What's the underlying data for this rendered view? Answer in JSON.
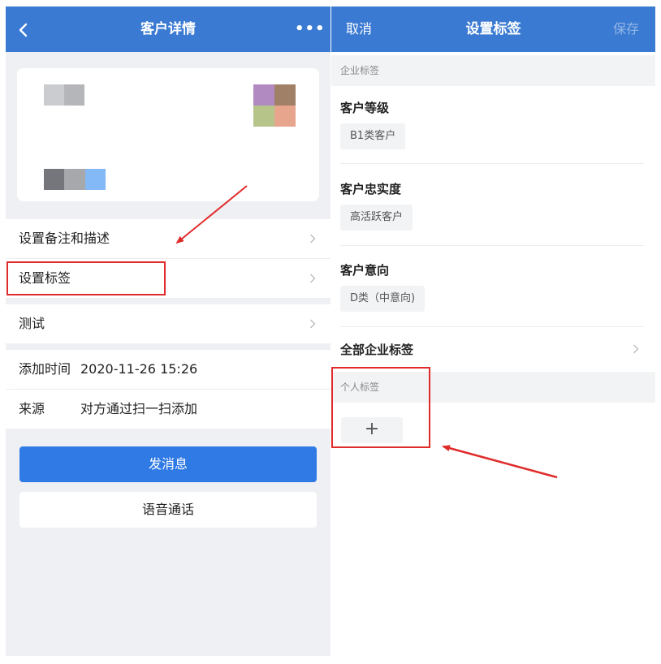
{
  "left": {
    "nav": {
      "title": "客户详情",
      "more": "•••"
    },
    "rows": {
      "remark": "设置备注和描述",
      "tags": "设置标签",
      "test": "测试",
      "add_time_label": "添加时间",
      "add_time_value": "2020-11-26 15:26",
      "source_label": "来源",
      "source_value": "对方通过扫一扫添加"
    },
    "buttons": {
      "send_message": "发消息",
      "voice_call": "语音通话"
    }
  },
  "right": {
    "nav": {
      "cancel": "取消",
      "title": "设置标签",
      "save": "保存"
    },
    "enterprise_section": "企业标签",
    "groups": [
      {
        "title": "客户等级",
        "tag": "B1类客户"
      },
      {
        "title": "客户忠实度",
        "tag": "高活跃客户"
      },
      {
        "title": "客户意向",
        "tag": "D类（中意向)"
      }
    ],
    "all_enterprise_tags": "全部企业标签",
    "personal_section": "个人标签",
    "add_symbol": "+"
  },
  "colors": {
    "nav_bg": "#3a7ad2",
    "primary_button": "#2f7ae5",
    "annotation": "#e02b2b",
    "page_bg": "#eff0f4"
  }
}
